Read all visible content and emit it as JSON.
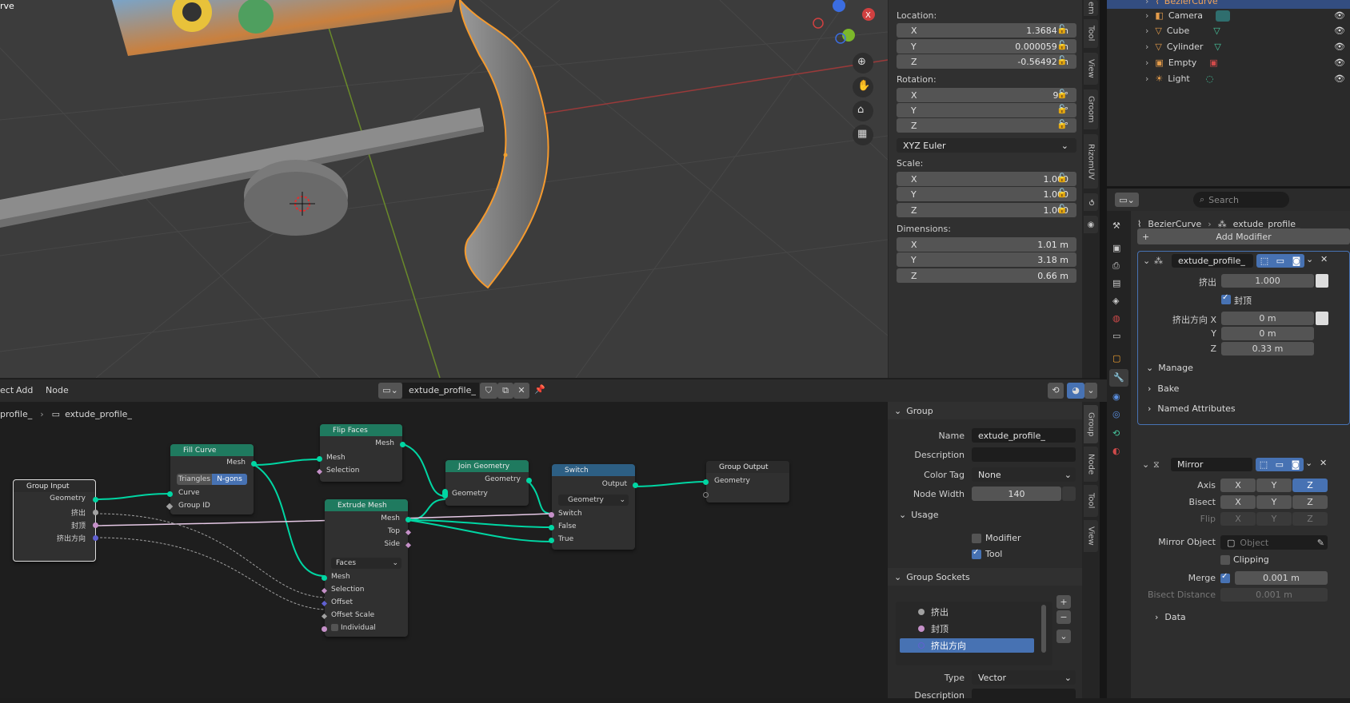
{
  "viewport": {
    "corner_text": "rve"
  },
  "npanel": {
    "location_label": "Location:",
    "location": [
      {
        "axis": "X",
        "value": "1.3684 m"
      },
      {
        "axis": "Y",
        "value": "0.000059 m"
      },
      {
        "axis": "Z",
        "value": "-0.56492 m"
      }
    ],
    "rotation_label": "Rotation:",
    "rotation": [
      {
        "axis": "X",
        "value": "90°"
      },
      {
        "axis": "Y",
        "value": "0°"
      },
      {
        "axis": "Z",
        "value": "0°"
      }
    ],
    "rotation_mode": "XYZ Euler",
    "scale_label": "Scale:",
    "scale": [
      {
        "axis": "X",
        "value": "1.000"
      },
      {
        "axis": "Y",
        "value": "1.000"
      },
      {
        "axis": "Z",
        "value": "1.000"
      }
    ],
    "dimensions_label": "Dimensions:",
    "dimensions": [
      {
        "axis": "X",
        "value": "1.01 m"
      },
      {
        "axis": "Y",
        "value": "3.18 m"
      },
      {
        "axis": "Z",
        "value": "0.66 m"
      }
    ]
  },
  "viewport_tabs": [
    "em",
    "Tool",
    "View",
    "Groom",
    "RizomUV"
  ],
  "outliner": {
    "items": [
      {
        "name": "BezierCurve"
      },
      {
        "name": "Camera"
      },
      {
        "name": "Cube"
      },
      {
        "name": "Cylinder"
      },
      {
        "name": "Empty"
      },
      {
        "name": "Light"
      }
    ]
  },
  "properties": {
    "search_placeholder": "Search",
    "breadcrumb_object": "BezierCurve",
    "breadcrumb_modifier": "extude_profile_",
    "add_modifier": "Add Modifier",
    "modifier1": {
      "name": "extude_profile_",
      "extrude_label": "挤出",
      "extrude_value": "1.000",
      "cap_label": "封顶",
      "dir_label": "挤出方向 X",
      "dir_x": "0 m",
      "y_label": "Y",
      "dir_y": "0 m",
      "z_label": "Z",
      "dir_z": "0.33 m",
      "manage": "Manage",
      "bake": "Bake",
      "named_attributes": "Named Attributes"
    },
    "modifier2": {
      "name": "Mirror",
      "axis_label": "Axis",
      "bisect_label": "Bisect",
      "flip_label": "Flip",
      "x": "X",
      "y": "Y",
      "z": "Z",
      "mirror_object_label": "Mirror Object",
      "mirror_object_placeholder": "Object",
      "clipping": "Clipping",
      "merge_label": "Merge",
      "merge_value": "0.001 m",
      "bisect_distance_label": "Bisect Distance",
      "bisect_distance_value": "0.001 m",
      "data": "Data"
    }
  },
  "node_header": {
    "menu_ect": "ect",
    "menu_add": "Add",
    "menu_node": "Node",
    "tree_name": "extude_profile_",
    "crumb_left": "profile_",
    "crumb_right": "extude_profile_"
  },
  "nodes": {
    "group_input": {
      "title": "Group Input",
      "geometry": "Geometry",
      "extrude": "挤出",
      "cap": "封顶",
      "direction": "挤出方向"
    },
    "fill_curve": {
      "title": "Fill Curve",
      "mesh": "Mesh",
      "triangles": "Triangles",
      "ngons": "N-gons",
      "curve": "Curve",
      "group_id": "Group ID"
    },
    "flip_faces": {
      "title": "Flip Faces",
      "mesh_out": "Mesh",
      "mesh_in": "Mesh",
      "selection": "Selection"
    },
    "extrude_mesh": {
      "title": "Extrude Mesh",
      "mesh_out": "Mesh",
      "top": "Top",
      "side": "Side",
      "mode": "Faces",
      "mesh_in": "Mesh",
      "selection": "Selection",
      "offset": "Offset",
      "offset_scale": "Offset Scale",
      "individual": "Individual"
    },
    "join_geometry": {
      "title": "Join Geometry",
      "geometry_out": "Geometry",
      "geometry_in": "Geometry"
    },
    "switch": {
      "title": "Switch",
      "output": "Output",
      "type": "Geometry",
      "switch": "Switch",
      "false": "False",
      "true": "True"
    },
    "group_output": {
      "title": "Group Output",
      "geometry": "Geometry"
    }
  },
  "node_tabs": [
    "Group",
    "Node",
    "Tool",
    "View"
  ],
  "group_panel": {
    "group_title": "Group",
    "name_label": "Name",
    "name_value": "extude_profile_",
    "description_label": "Description",
    "description_value": "",
    "color_tag_label": "Color Tag",
    "color_tag_value": "None",
    "node_width_label": "Node Width",
    "node_width_value": "140",
    "usage_title": "Usage",
    "modifier_label": "Modifier",
    "tool_label": "Tool",
    "sockets_title": "Group Sockets",
    "sockets": [
      "挤出",
      "封顶",
      "挤出方向"
    ],
    "type_label": "Type",
    "type_value": "Vector",
    "description2_label": "Description"
  },
  "colors": {
    "accent": "#4772b3",
    "geometry_socket": "#00d6a3",
    "selection": "#f19c3c"
  }
}
